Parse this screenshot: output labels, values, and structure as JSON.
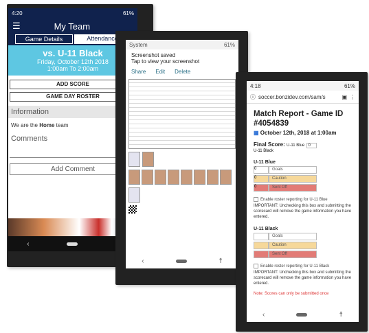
{
  "phone1": {
    "status_time": "4:20",
    "status_battery": "61%",
    "header_title": "My Team",
    "menu_icon": "hamburger-menu-icon",
    "tabs": [
      "Game Details",
      "Attendance"
    ],
    "game_title": "vs. U-11 Black",
    "game_date": "Friday, October 12th 2018",
    "game_time": "1:00am To 2:00am",
    "add_score_label": "ADD SCORE",
    "roster_label": "GAME DAY ROSTER",
    "info_title": "Information",
    "info_text_pre": "We are the ",
    "info_text_bold": "Home",
    "info_text_post": " team",
    "comments_title": "Comments",
    "add_comment_label": "Add Comment"
  },
  "phone2": {
    "status_left": "System",
    "status_battery": "61%",
    "notif_title": "Screenshot saved",
    "notif_sub": "Tap to view your screenshot",
    "actions": [
      "Share",
      "Edit",
      "Delete"
    ]
  },
  "phone3": {
    "status_time": "4:18",
    "status_battery": "61%",
    "url": "soccer.bonzidev.com/sam/s",
    "report_title": "Match Report - Game ID #4054839",
    "report_date": "October 12th, 2018 at 1:00am",
    "final_score_label": "Final Score:",
    "team_home": "U-11 Blue",
    "team_away": "U-11 Black",
    "home_score": "0",
    "home_rows": [
      {
        "value": "0",
        "label": "Goals"
      },
      {
        "value": "0",
        "label": "Caution"
      },
      {
        "value": "0",
        "label": "Sent Off"
      }
    ],
    "away_rows": [
      {
        "value": "",
        "label": "Goals"
      },
      {
        "value": "",
        "label": "Caution"
      },
      {
        "value": "",
        "label": "Sent Off"
      }
    ],
    "roster_home": "Enable roster reporting for U-11 Blue",
    "roster_away": "Enable roster reporting for U-11 Black",
    "important_home": "IMPORTANT: Unchecking this box and submitting the scorecard will remove the game information you have entered.",
    "important_away": "IMPORTANT: Unchecking this box and submitting the scorecard will remove the game information you have entered.",
    "note": "Note: Scores can only be submitted once"
  },
  "colors": {
    "navy": "#10224d",
    "sky": "#5ec7e2",
    "caution": "#f6d89a",
    "sentoff": "#e27b76"
  }
}
